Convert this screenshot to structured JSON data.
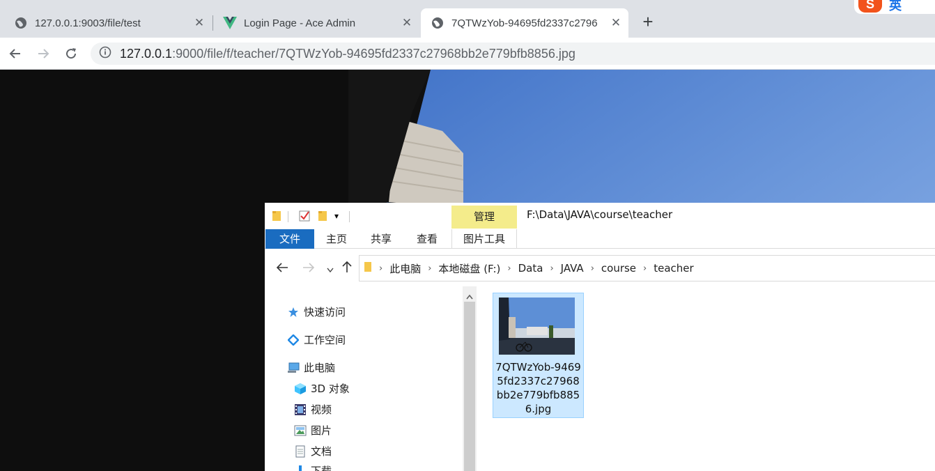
{
  "browser": {
    "tabs": [
      {
        "title": "127.0.0.1:9003/file/test",
        "icon": "globe-icon",
        "active": false
      },
      {
        "title": "Login Page - Ace Admin",
        "icon": "vue-logo-icon",
        "active": false
      },
      {
        "title": "7QTWzYob-94695fd2337c2796",
        "icon": "globe-icon",
        "active": true
      }
    ],
    "new_tab_label": "+",
    "ime_label": "英",
    "url_host": "127.0.0.1",
    "url_rest": ":9000/file/f/teacher/7QTWzYob-94695fd2337c27968bb2e779bfb8856.jpg"
  },
  "explorer": {
    "context_tab": "管理",
    "window_path": "F:\\Data\\JAVA\\course\\teacher",
    "ribbon_tabs": [
      "文件",
      "主页",
      "共享",
      "查看"
    ],
    "context_sub_tab": "图片工具",
    "breadcrumb": [
      "此电脑",
      "本地磁盘 (F:)",
      "Data",
      "JAVA",
      "course",
      "teacher"
    ],
    "nav": {
      "quick_access": "快速访问",
      "workspace": "工作空间",
      "this_pc": "此电脑",
      "objects_3d": "3D 对象",
      "videos": "视频",
      "pictures": "图片",
      "documents": "文档",
      "downloads": "下载"
    },
    "file": {
      "name": "7QTWzYob-94695fd2337c27968bb2e779bfb8856.jpg"
    }
  },
  "colors": {
    "file_tab": "#1a6cc0",
    "context_tab": "#f4ec8b",
    "selection": "#cce8ff",
    "sky": "#6e98d8"
  }
}
